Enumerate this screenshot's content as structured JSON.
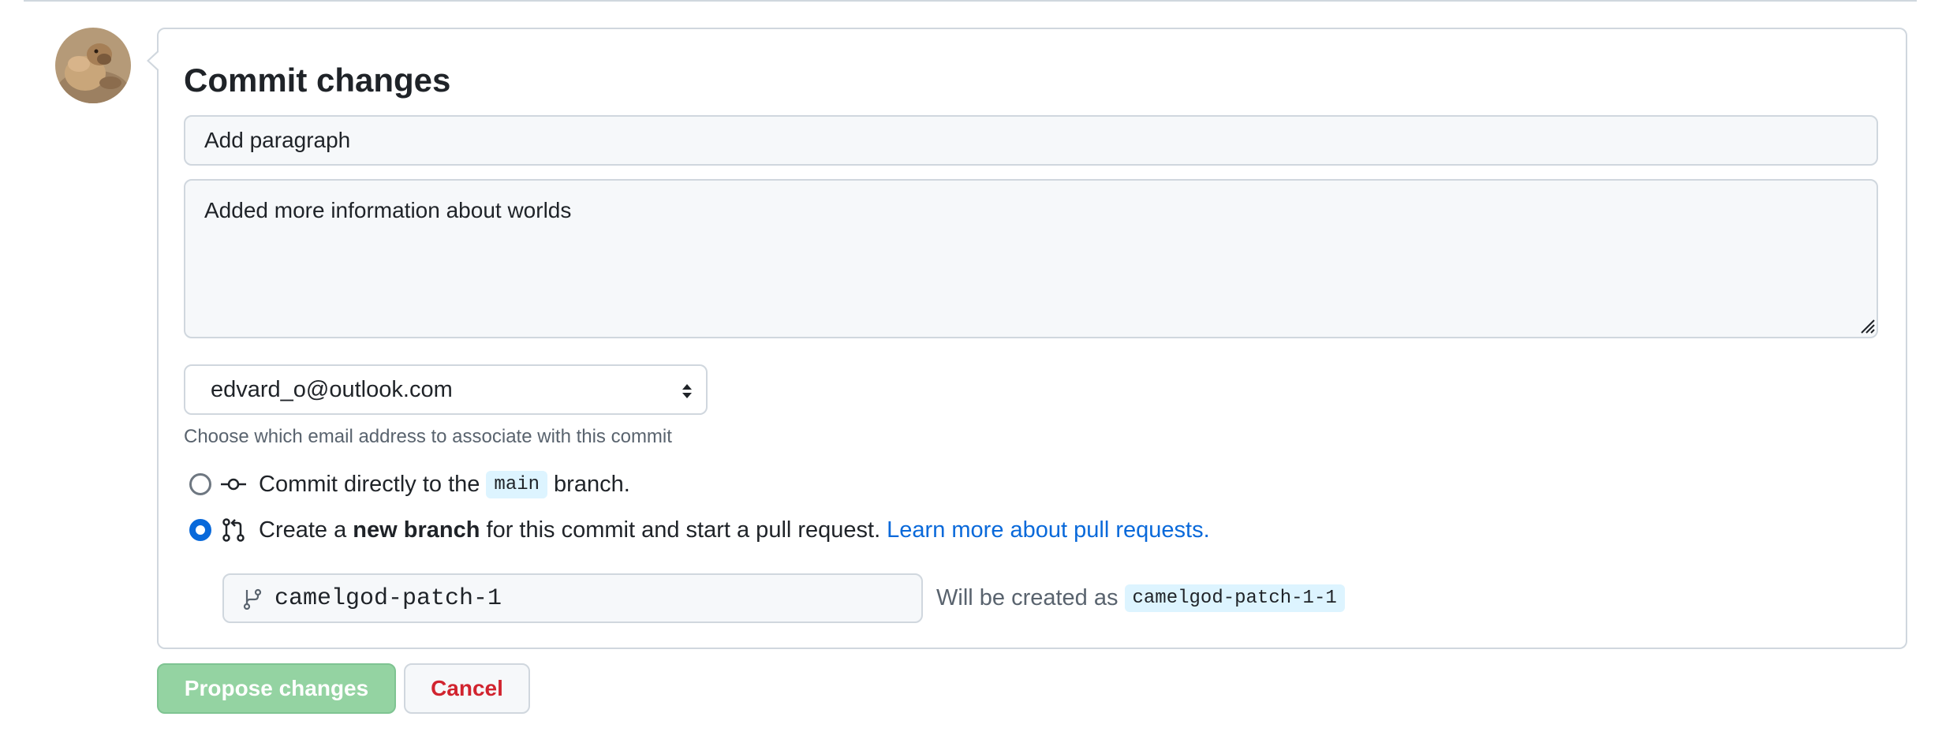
{
  "form": {
    "title": "Commit changes",
    "summary_value": "Add paragraph",
    "description_value": "Added more information about worlds",
    "email_selected": "edvard_o@outlook.com",
    "email_hint": "Choose which email address to associate with this commit"
  },
  "options": {
    "direct": {
      "prefix": "Commit directly to the",
      "branch": "main",
      "suffix": "branch.",
      "selected": false
    },
    "new_branch": {
      "prefix": "Create a",
      "bold": "new branch",
      "suffix": "for this commit and start a pull request.",
      "link": "Learn more about pull requests.",
      "selected": true
    }
  },
  "branch": {
    "name_value": "camelgod-patch-1",
    "created_as_label": "Will be created as",
    "created_as_name": "camelgod-patch-1-1"
  },
  "buttons": {
    "propose": "Propose changes",
    "cancel": "Cancel"
  },
  "colors": {
    "accent": "#0969da",
    "propose_disabled": "#94d3a2",
    "cancel_text": "#d1242f",
    "chip_bg": "#ddf4ff"
  },
  "icons": {
    "avatar": "camel-avatar",
    "commit": "git-commit-icon",
    "pull_request": "git-pull-request-icon",
    "branch": "git-branch-icon",
    "select_arrows": "select-arrows-icon",
    "resize": "resize-handle-icon"
  }
}
